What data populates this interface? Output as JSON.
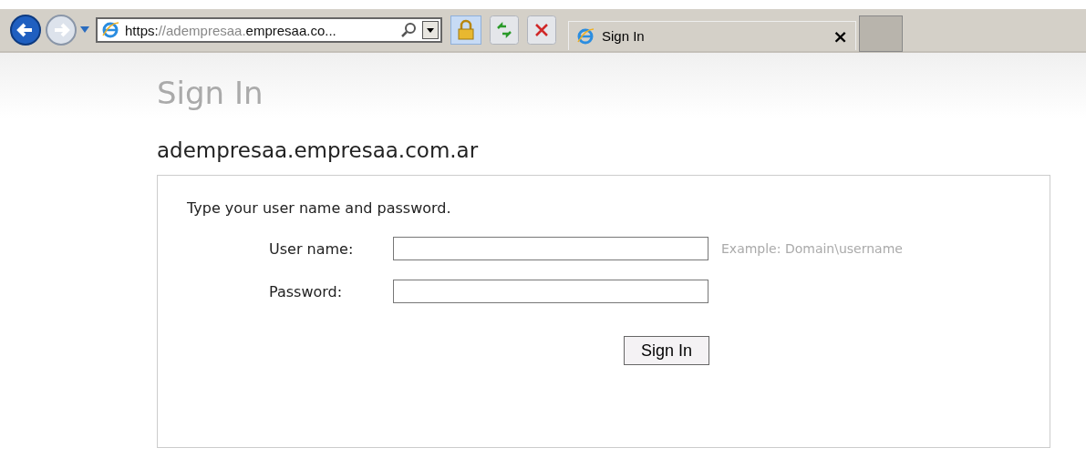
{
  "toolbar": {
    "url_segments": [
      {
        "text": "https:",
        "dim": false
      },
      {
        "text": "//adempresaa.",
        "dim": true
      },
      {
        "text": "empresaa.co...",
        "dim": false
      }
    ],
    "tab": {
      "title": "Sign In",
      "close": "×"
    }
  },
  "page": {
    "title": "Sign In",
    "domain": "adempresaa.empresaa.com.ar",
    "instructions": "Type your user name and password.",
    "fields": [
      {
        "label": "User name:",
        "hint": "Example: Domain\\username"
      },
      {
        "label": "Password:"
      }
    ],
    "submit": "Sign In"
  }
}
